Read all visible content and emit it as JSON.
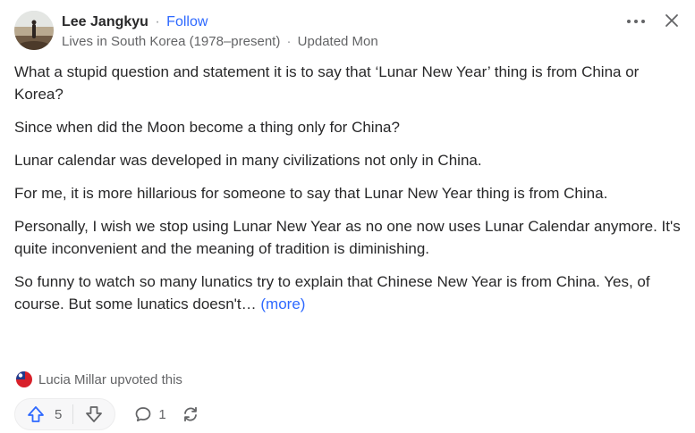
{
  "author": {
    "name": "Lee Jangkyu",
    "separator": "·",
    "follow_label": "Follow",
    "credential": "Lives in South Korea (1978–present)",
    "updated": "Updated Mon"
  },
  "header": {
    "more_icon": "more-horizontal-icon",
    "close_icon": "close-icon"
  },
  "answer": {
    "paragraphs": [
      "What a stupid question and statement it is to say that ‘Lunar New Year’ thing is from China or Korea?",
      "Since when did the Moon become a thing only for China?",
      "Lunar calendar was developed in many civilizations not only in China.",
      "For me, it is more hillarious for someone to say that Lunar New Year thing is from China.",
      "Personally, I wish we stop using Lunar New Year as no one now uses Lunar Calendar anymore. It's quite inconvenient and the meaning of tradition is diminishing."
    ],
    "last_paragraph": "So funny to watch so many lunatics try to explain that Chinese New Year is from China. Yes, of course. But some lunatics doesn't…",
    "more_label": "(more)"
  },
  "upvoted_by": "Lucia Millar upvoted this",
  "actions": {
    "upvotes": "5",
    "comments": "1"
  },
  "colors": {
    "link": "#2e69ff",
    "text": "#282829",
    "secondary": "#636466"
  }
}
